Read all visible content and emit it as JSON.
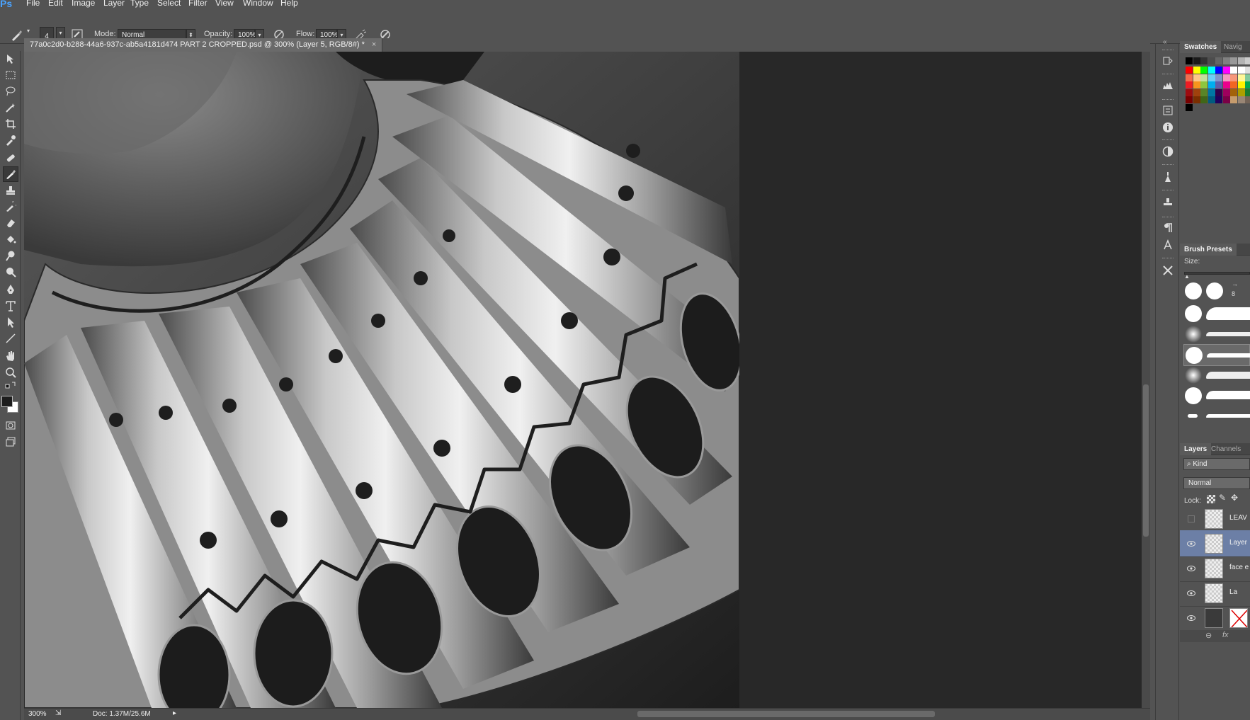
{
  "app": {
    "logo": "Ps"
  },
  "menu": [
    "File",
    "Edit",
    "Image",
    "Layer",
    "Type",
    "Select",
    "Filter",
    "View",
    "Window",
    "Help"
  ],
  "options": {
    "brush_size": "4",
    "mode_label": "Mode:",
    "mode_value": "Normal",
    "opacity_label": "Opacity:",
    "opacity_value": "100%",
    "flow_label": "Flow:",
    "flow_value": "100%"
  },
  "document": {
    "tab_title": "77a0c2d0-b288-44a6-937c-ab5a4181d474 PART 2 CROPPED.psd @ 300% (Layer 5, RGB/8#) *",
    "close_glyph": "×"
  },
  "status": {
    "zoom": "300%",
    "doc": "Doc: 1.37M/25.6M"
  },
  "panels": {
    "swatches_tab": "Swatches",
    "navigator_tab": "Navig",
    "brush_presets_tab": "Brush Presets",
    "size_label": "Size:",
    "brush_count": "8",
    "layers_tab": "Layers",
    "channels_tab": "Channels",
    "kind_filter": "Kind",
    "blend_mode": "Normal",
    "lock_label": "Lock:",
    "layers": [
      {
        "name": "LEAV",
        "visible": false,
        "selected": false
      },
      {
        "name": "Layer",
        "visible": true,
        "selected": true
      },
      {
        "name": "face e",
        "visible": true,
        "selected": false
      },
      {
        "name": "La",
        "visible": true,
        "selected": false
      },
      {
        "name": "",
        "visible": true,
        "selected": false
      }
    ]
  },
  "swatch_colors": [
    [
      "#ff0000",
      "#ffff00",
      "#00ff00",
      "#00ffff",
      "#0000ff",
      "#ff00ff",
      "#ffffff",
      "#ffffff",
      "#e0e0e0"
    ],
    [
      "#f26c4f",
      "#fdc689",
      "#c4df9b",
      "#6dcff6",
      "#8393ca",
      "#f49ac1",
      "#f7977a",
      "#fff799",
      "#82ca9c"
    ],
    [
      "#ed1c24",
      "#f7941d",
      "#8dc63f",
      "#00aeef",
      "#605ca8",
      "#ec008c",
      "#f26522",
      "#fff200",
      "#00a651"
    ],
    [
      "#9e0b0f",
      "#a0410d",
      "#598527",
      "#0076a3",
      "#32004b",
      "#9e005d",
      "#a36209",
      "#aba000",
      "#197b30"
    ],
    [
      "#790000",
      "#7b2e00",
      "#406618",
      "#005b7f",
      "#21005d",
      "#7b0046",
      "#c69c6d",
      "#998675",
      "#736357"
    ],
    [
      "#000000"
    ]
  ]
}
